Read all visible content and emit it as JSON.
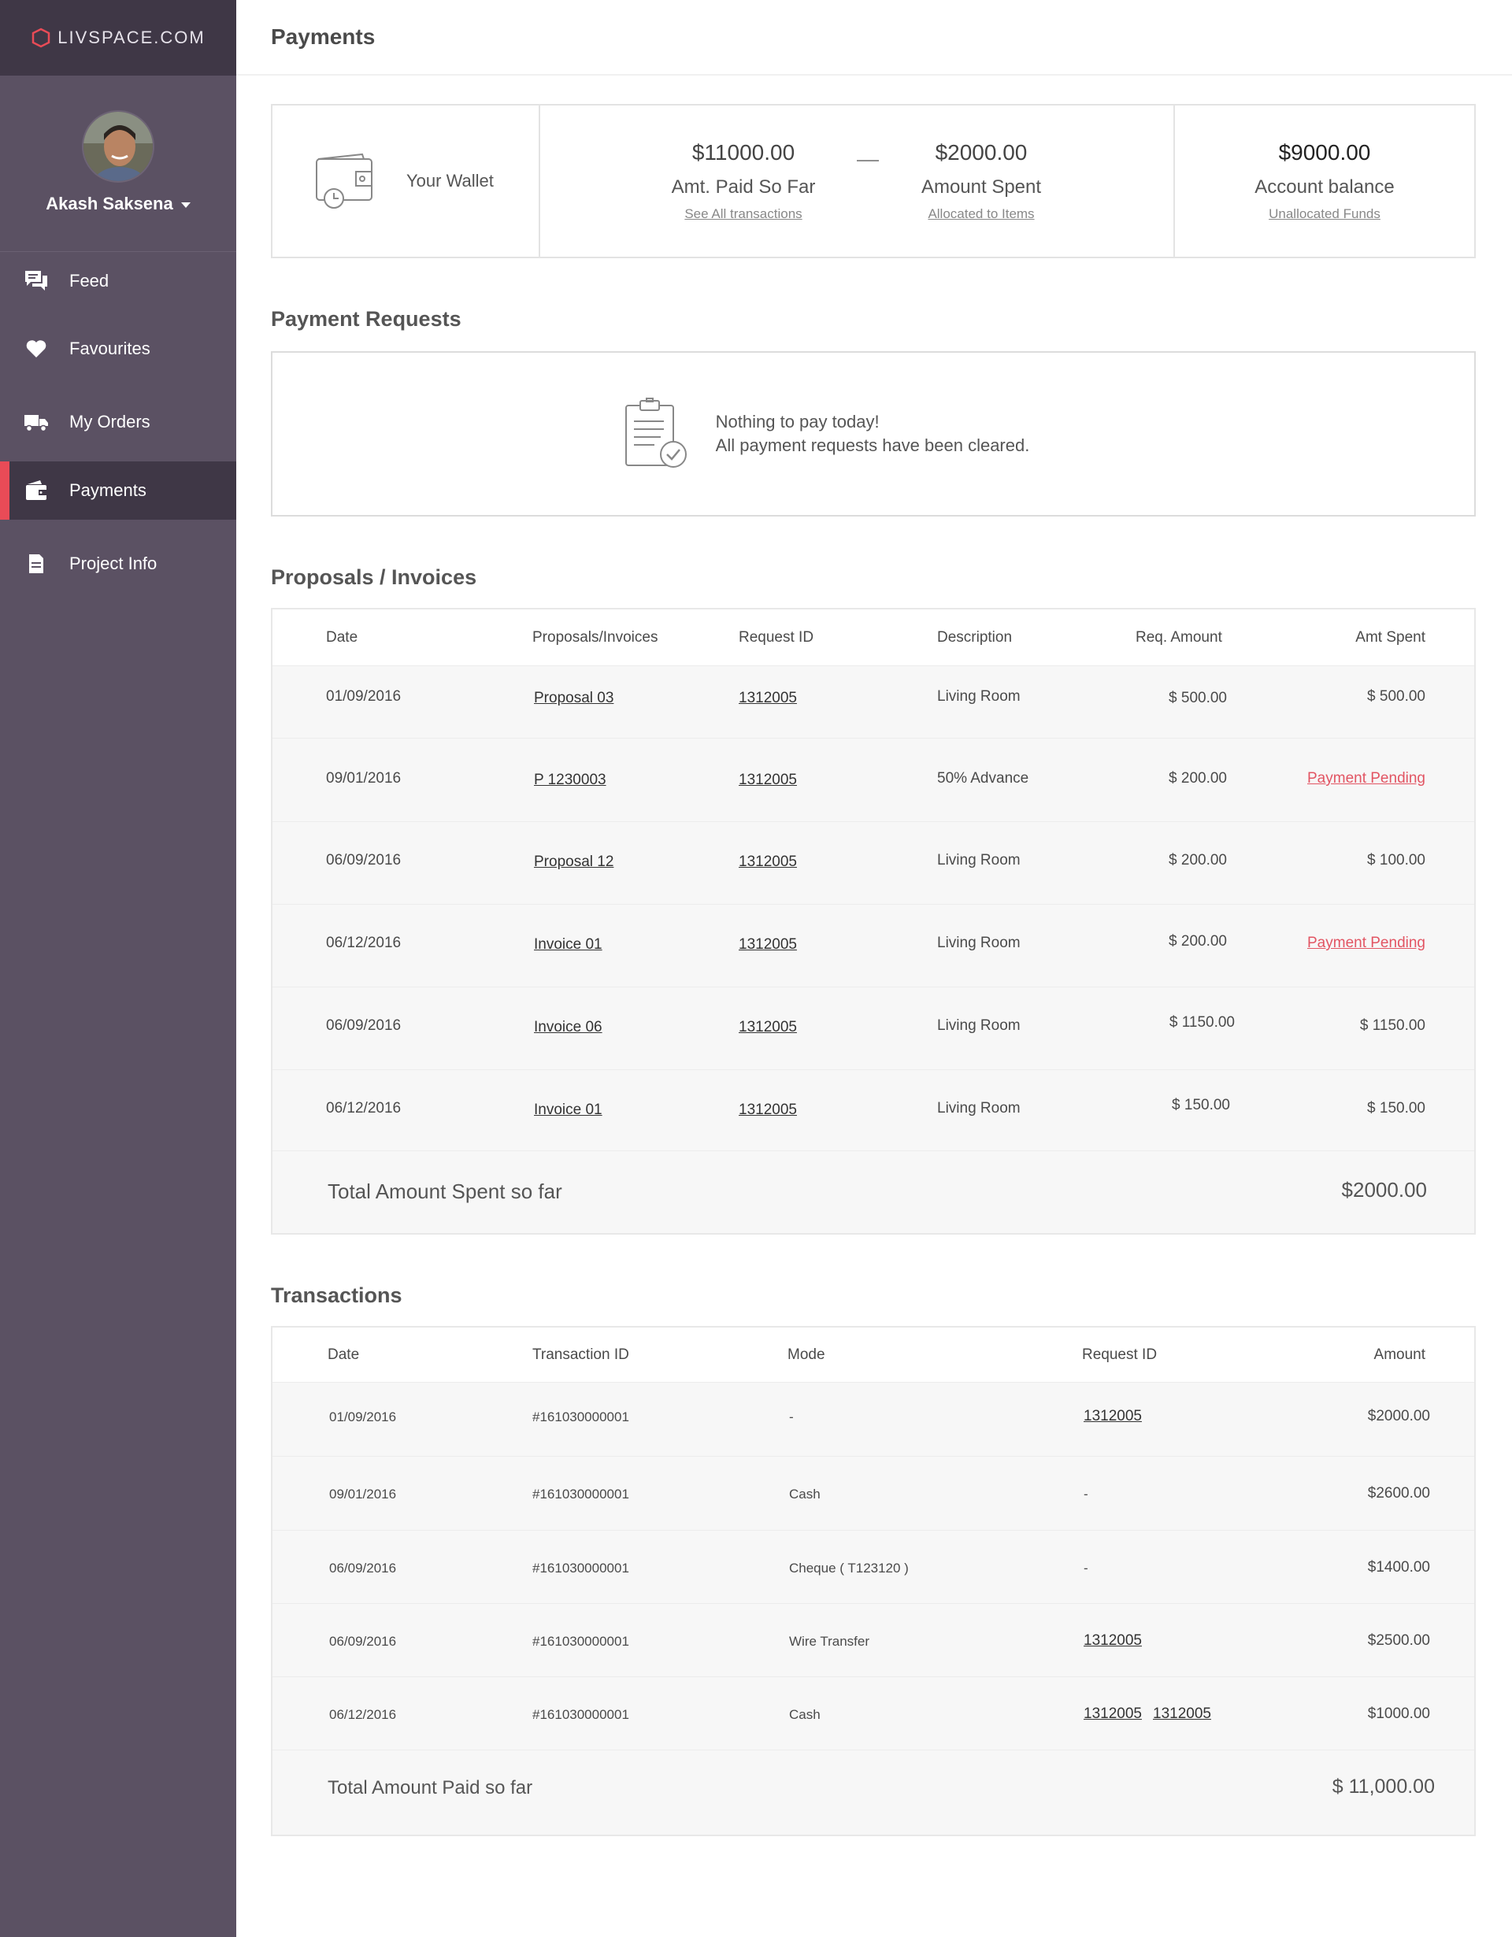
{
  "brand": {
    "name": "LIVSPACE.COM",
    "accent": "#e94b57"
  },
  "user": {
    "name": "Akash Saksena"
  },
  "nav": {
    "items": [
      {
        "label": "Feed",
        "icon": "chat-icon"
      },
      {
        "label": "Favourites",
        "icon": "heart-icon"
      },
      {
        "label": "My Orders",
        "icon": "truck-icon"
      },
      {
        "label": "Payments",
        "icon": "wallet-icon",
        "active": true
      },
      {
        "label": "Project Info",
        "icon": "document-icon"
      }
    ]
  },
  "page": {
    "title": "Payments"
  },
  "wallet": {
    "label": "Your Wallet",
    "paid": {
      "amount": "$11000.00",
      "label": "Amt. Paid So Far",
      "link": "See All transactions"
    },
    "separator": "—",
    "spent": {
      "amount": "$2000.00",
      "label": "Amount Spent",
      "link": "Allocated to Items"
    },
    "balance": {
      "amount": "$9000.00",
      "label": "Account balance",
      "link": "Unallocated Funds"
    }
  },
  "payment_requests": {
    "title": "Payment Requests",
    "line1": "Nothing to pay today!",
    "line2": "All payment requests have been cleared."
  },
  "proposals": {
    "title": "Proposals / Invoices",
    "headers": {
      "date": "Date",
      "doc": "Proposals/Invoices",
      "req_id": "Request ID",
      "desc": "Description",
      "req_amt": "Req. Amount",
      "spent": "Amt Spent"
    },
    "rows": [
      {
        "date": "01/09/2016",
        "doc": "Proposal 03",
        "req_id": "1312005",
        "desc": "Living Room",
        "req_amt": "$ 500.00",
        "spent": "$ 500.00",
        "pending": false
      },
      {
        "date": "09/01/2016",
        "doc": "P 1230003",
        "req_id": "1312005",
        "desc": "50% Advance",
        "req_amt": "$ 200.00",
        "spent": "Payment Pending",
        "pending": true
      },
      {
        "date": "06/09/2016",
        "doc": "Proposal 12",
        "req_id": "1312005",
        "desc": "Living Room",
        "req_amt": "$ 200.00",
        "spent": "$ 100.00",
        "pending": false
      },
      {
        "date": "06/12/2016",
        "doc": "Invoice 01",
        "req_id": "1312005",
        "desc": "Living Room",
        "req_amt": "$ 200.00",
        "spent": "Payment Pending",
        "pending": true
      },
      {
        "date": "06/09/2016",
        "doc": "Invoice 06",
        "req_id": "1312005",
        "desc": "Living Room",
        "req_amt": "$ 1150.00",
        "spent": "$ 1150.00",
        "pending": false
      },
      {
        "date": "06/12/2016",
        "doc": "Invoice 01",
        "req_id": "1312005",
        "desc": "Living Room",
        "req_amt": "$ 150.00",
        "spent": "$ 150.00",
        "pending": false
      }
    ],
    "total_label": "Total Amount Spent so far",
    "total_value": "$2000.00"
  },
  "transactions": {
    "title": "Transactions",
    "headers": {
      "date": "Date",
      "txn_id": "Transaction ID",
      "mode": "Mode",
      "req_id": "Request ID",
      "amount": "Amount"
    },
    "rows": [
      {
        "date": "01/09/2016",
        "txn_id": "#161030000001",
        "mode": "-",
        "req_ids": [
          "1312005"
        ],
        "amount": "$2000.00"
      },
      {
        "date": "09/01/2016",
        "txn_id": "#161030000001",
        "mode": "Cash",
        "req_ids": [],
        "req_dash": "-",
        "amount": "$2600.00"
      },
      {
        "date": "06/09/2016",
        "txn_id": "#161030000001",
        "mode": "Cheque ( T123120 )",
        "req_ids": [],
        "req_dash": "-",
        "amount": "$1400.00"
      },
      {
        "date": "06/09/2016",
        "txn_id": "#161030000001",
        "mode": "Wire Transfer",
        "req_ids": [
          "1312005"
        ],
        "amount": "$2500.00"
      },
      {
        "date": "06/12/2016",
        "txn_id": "#161030000001",
        "mode": "Cash",
        "req_ids": [
          "1312005",
          "1312005"
        ],
        "amount": "$1000.00"
      }
    ],
    "total_label": "Total Amount Paid so far",
    "total_value": "$ 11,000.00"
  }
}
